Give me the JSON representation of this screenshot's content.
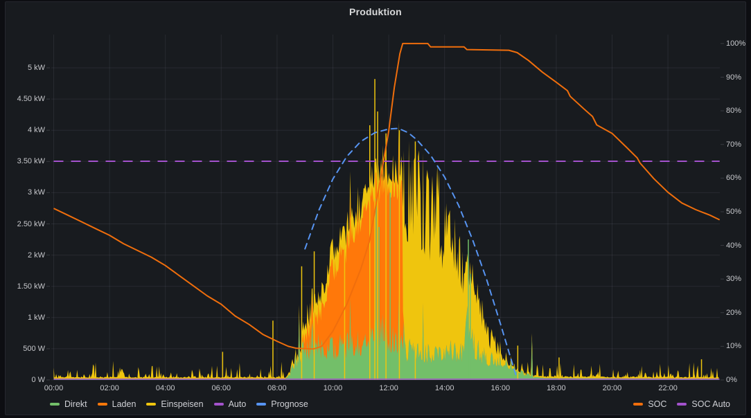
{
  "panel": {
    "title": "Produktion"
  },
  "colors": {
    "background": "#0d0e12",
    "panel_background": "#181b1f",
    "grid": "rgba(204,204,220,0.09)",
    "axis_text": "#c7c8cc",
    "title_text": "#d8d9da"
  },
  "chart_data": {
    "type": "area",
    "title": "Produktion",
    "x_axis": {
      "tick_labels": [
        "00:00",
        "02:00",
        "04:00",
        "06:00",
        "08:00",
        "10:00",
        "12:00",
        "14:00",
        "16:00",
        "18:00",
        "20:00",
        "22:00"
      ],
      "tick_hours": [
        0,
        2,
        4,
        6,
        8,
        10,
        12,
        14,
        16,
        18,
        20,
        22
      ],
      "range_hours": [
        0,
        24
      ]
    },
    "y_left": {
      "ticks": [
        "0 W",
        "500 W",
        "1 kW",
        "1.50 kW",
        "2 kW",
        "2.50 kW",
        "3 kW",
        "3.50 kW",
        "4 kW",
        "4.50 kW",
        "5 kW"
      ],
      "tick_values_kw": [
        0,
        0.5,
        1,
        1.5,
        2,
        2.5,
        3,
        3.5,
        4,
        4.5,
        5
      ],
      "range_kw": [
        0,
        5.53
      ]
    },
    "y_right": {
      "ticks": [
        "0%",
        "10%",
        "20%",
        "30%",
        "40%",
        "50%",
        "60%",
        "70%",
        "80%",
        "90%",
        "100%"
      ],
      "tick_values_pct": [
        0,
        10,
        20,
        30,
        40,
        50,
        60,
        70,
        80,
        90,
        100
      ],
      "range_pct": [
        0,
        102.7
      ]
    },
    "grid": true,
    "legend_position": "bottom",
    "series": [
      {
        "name": "Direkt",
        "color": "#73BF69",
        "render": "area-stack",
        "axis": "left",
        "unit": "kW",
        "points": [
          [
            0,
            0.02
          ],
          [
            8.3,
            0.02
          ],
          [
            8.45,
            0.1
          ],
          [
            8.7,
            0.35
          ],
          [
            9,
            0.55
          ],
          [
            9.5,
            0.6
          ],
          [
            10,
            0.55
          ],
          [
            10.5,
            0.6
          ],
          [
            11,
            0.65
          ],
          [
            11.4,
            0.75
          ],
          [
            11.8,
            0.9
          ],
          [
            12,
            0.65
          ],
          [
            12.3,
            0.7
          ],
          [
            12.5,
            0.55
          ],
          [
            13,
            0.5
          ],
          [
            13.5,
            0.45
          ],
          [
            14,
            0.5
          ],
          [
            14.6,
            0.5
          ],
          [
            14.82,
            1.1
          ],
          [
            14.88,
            0.9
          ],
          [
            15.1,
            0.55
          ],
          [
            15.5,
            0.4
          ],
          [
            16,
            0.35
          ],
          [
            16.4,
            0.25
          ],
          [
            16.8,
            0.12
          ],
          [
            17.2,
            0.05
          ],
          [
            17.6,
            0.03
          ],
          [
            24,
            0.02
          ]
        ]
      },
      {
        "name": "Laden",
        "color": "#FF780A",
        "render": "area-stack",
        "axis": "left",
        "unit": "kW",
        "points": [
          [
            0,
            0
          ],
          [
            8.85,
            0
          ],
          [
            9.1,
            0.35
          ],
          [
            9.5,
            0.5
          ],
          [
            10,
            1.3
          ],
          [
            10.5,
            1.6
          ],
          [
            11,
            2.1
          ],
          [
            11.5,
            2.35
          ],
          [
            12,
            2.55
          ],
          [
            12.3,
            2.55
          ],
          [
            12.48,
            2.6
          ],
          [
            12.52,
            0
          ],
          [
            24,
            0
          ]
        ]
      },
      {
        "name": "Einspeisen",
        "color": "#EFC50E",
        "render": "area-stack",
        "axis": "left",
        "unit": "kW",
        "points": [
          [
            0,
            0.02
          ],
          [
            8.4,
            0.03
          ],
          [
            8.6,
            0.12
          ],
          [
            9,
            0.2
          ],
          [
            9.5,
            0.25
          ],
          [
            10,
            0.3
          ],
          [
            11,
            0.3
          ],
          [
            12,
            0.25
          ],
          [
            12.48,
            0.3
          ],
          [
            12.52,
            2.9
          ],
          [
            12.8,
            2.85
          ],
          [
            13,
            2.75
          ],
          [
            13.3,
            2.6
          ],
          [
            13.6,
            2.4
          ],
          [
            14,
            2.1
          ],
          [
            14.5,
            1.6
          ],
          [
            15,
            1.0
          ],
          [
            15.3,
            0.75
          ],
          [
            15.6,
            0.45
          ],
          [
            16,
            0.18
          ],
          [
            16.3,
            0.07
          ],
          [
            16.55,
            0.02
          ],
          [
            24,
            0.02
          ]
        ]
      },
      {
        "name": "Auto",
        "color": "#A352CC",
        "render": "line",
        "axis": "left",
        "unit": "kW",
        "points": [
          [
            0,
            0.012
          ],
          [
            23.85,
            0.012
          ]
        ]
      },
      {
        "name": "Prognose",
        "color": "#5794F2",
        "render": "line-dash",
        "axis": "left",
        "unit": "kW",
        "points": [
          [
            9,
            2.1
          ],
          [
            9.5,
            2.72
          ],
          [
            10,
            3.22
          ],
          [
            10.5,
            3.58
          ],
          [
            11,
            3.82
          ],
          [
            11.5,
            3.96
          ],
          [
            12,
            4.02
          ],
          [
            12.35,
            4.03
          ],
          [
            12.7,
            3.96
          ],
          [
            13,
            3.85
          ],
          [
            13.5,
            3.6
          ],
          [
            14,
            3.25
          ],
          [
            14.5,
            2.8
          ],
          [
            15,
            2.25
          ],
          [
            15.5,
            1.62
          ],
          [
            16,
            0.9
          ],
          [
            16.55,
            0.08
          ]
        ]
      },
      {
        "name": "SOC",
        "color": "#F06E0C",
        "render": "line",
        "axis": "right",
        "unit": "%",
        "points": [
          [
            0,
            51
          ],
          [
            0.5,
            49
          ],
          [
            1,
            47
          ],
          [
            1.5,
            45
          ],
          [
            2,
            43
          ],
          [
            2.5,
            40.5
          ],
          [
            3,
            38.5
          ],
          [
            3.5,
            36.5
          ],
          [
            4,
            34
          ],
          [
            4.5,
            31
          ],
          [
            5,
            28
          ],
          [
            5.5,
            25
          ],
          [
            6,
            22.5
          ],
          [
            6.5,
            19
          ],
          [
            7,
            16.5
          ],
          [
            7.5,
            13.5
          ],
          [
            8,
            11.5
          ],
          [
            8.4,
            10
          ],
          [
            8.7,
            9.4
          ],
          [
            9.3,
            9.2
          ],
          [
            9.6,
            10
          ],
          [
            10,
            14.5
          ],
          [
            10.5,
            22.5
          ],
          [
            11,
            33
          ],
          [
            11.3,
            41
          ],
          [
            11.5,
            50
          ],
          [
            11.75,
            62
          ],
          [
            12,
            74
          ],
          [
            12.2,
            87
          ],
          [
            12.4,
            97
          ],
          [
            12.5,
            100
          ],
          [
            13.4,
            100
          ],
          [
            13.5,
            99
          ],
          [
            14.7,
            99
          ],
          [
            14.8,
            98.2
          ],
          [
            16.3,
            98
          ],
          [
            16.6,
            97.3
          ],
          [
            17,
            95
          ],
          [
            17.5,
            91.5
          ],
          [
            18,
            88.5
          ],
          [
            18.4,
            86
          ],
          [
            18.5,
            84.3
          ],
          [
            19,
            80.5
          ],
          [
            19.3,
            78.3
          ],
          [
            19.45,
            75.8
          ],
          [
            20,
            73.3
          ],
          [
            20.5,
            69.3
          ],
          [
            20.9,
            66
          ],
          [
            21,
            64.5
          ],
          [
            21.5,
            59.8
          ],
          [
            22,
            55.8
          ],
          [
            22.5,
            52.6
          ],
          [
            23,
            50.6
          ],
          [
            23.5,
            49
          ],
          [
            23.85,
            47.6
          ]
        ]
      },
      {
        "name": "SOC Auto",
        "color": "#A352CC",
        "render": "line-dash",
        "axis": "right",
        "unit": "%",
        "points": [
          [
            0,
            65
          ],
          [
            23.85,
            65
          ]
        ]
      }
    ],
    "spikes": {
      "einspeisen": [
        [
          6.05,
          0.45
        ],
        [
          7.85,
          0.95
        ],
        [
          8.88,
          1.82
        ],
        [
          9.33,
          2.06
        ],
        [
          10.42,
          2.3
        ],
        [
          11.32,
          4.08
        ],
        [
          11.5,
          4.82
        ],
        [
          11.6,
          4.3
        ],
        [
          11.9,
          3.95
        ],
        [
          12.38,
          4.0
        ],
        [
          12.95,
          3.82
        ],
        [
          16.62,
          0.55
        ],
        [
          18.1,
          0.36
        ],
        [
          23.2,
          0.33
        ]
      ],
      "direkt": [
        [
          11.55,
          2.9
        ],
        [
          11.65,
          2.45
        ],
        [
          12.05,
          3.0
        ],
        [
          14.85,
          2.25
        ],
        [
          14.92,
          1.7
        ]
      ]
    },
    "legend_left": [
      "Direkt",
      "Laden",
      "Einspeisen",
      "Auto",
      "Prognose"
    ],
    "legend_right": [
      "SOC",
      "SOC Auto"
    ]
  }
}
